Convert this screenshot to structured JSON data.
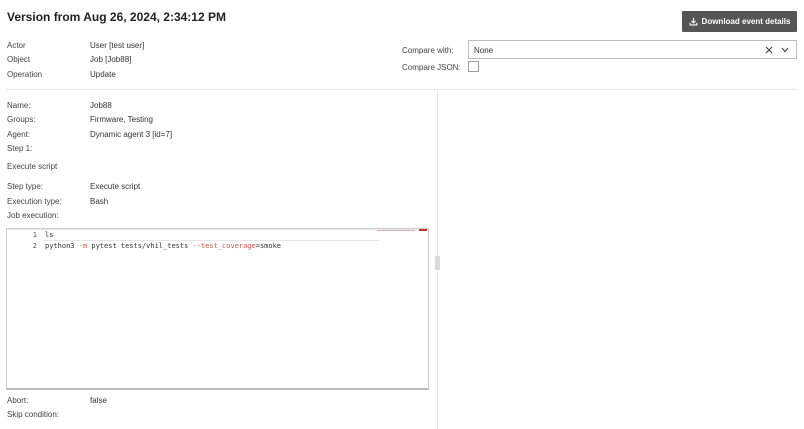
{
  "header": {
    "title": "Version from Aug 26, 2024, 2:34:12 PM",
    "download_label": "Download event details"
  },
  "meta": {
    "actor_label": "Actor",
    "actor_value": "User  [test user]",
    "object_label": "Object",
    "object_value": "Job  [Job88]",
    "operation_label": "Operation",
    "operation_value": "Update"
  },
  "compare": {
    "compare_with_label": "Compare with:",
    "compare_with_value": "None",
    "compare_json_label": "Compare JSON:",
    "compare_json_checked": false
  },
  "details": {
    "name_label": "Name:",
    "name_value": "Job88",
    "groups_label": "Groups:",
    "groups_value": "Firmware, Testing",
    "agent_label": "Agent:",
    "agent_value": "Dynamic agent 3 [id=7]",
    "step_label": "Step 1:",
    "step_title": "Execute script",
    "step_type_label": "Step type:",
    "step_type_value": "Execute script",
    "execution_type_label": "Execution type:",
    "execution_type_value": "Bash",
    "job_execution_label": "Job execution:",
    "abort_label": "Abort:",
    "abort_value": "false",
    "skip_condition_label": "Skip condition:"
  },
  "editor": {
    "lines": [
      {
        "number": "1",
        "code": "ls"
      },
      {
        "number": "2",
        "code_parts": [
          "python3 ",
          "-m",
          " pytest tests/vhil_tests ",
          "--test_coverage",
          "=smoke"
        ]
      }
    ]
  },
  "icons": {
    "download": "download-icon",
    "clear": "close-icon",
    "dropdown": "chevron-down-icon"
  },
  "colors": {
    "button_bg": "#555555",
    "code_option": "#d9534f"
  }
}
